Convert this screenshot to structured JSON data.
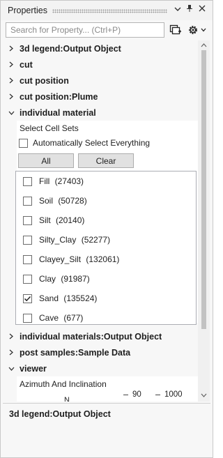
{
  "panel": {
    "title": "Properties",
    "search_placeholder": "Search for Property... (Ctrl+P)"
  },
  "tree_items": [
    {
      "label": "3d legend:Output Object",
      "expanded": false
    },
    {
      "label": "cut",
      "expanded": false
    },
    {
      "label": "cut position",
      "expanded": false
    },
    {
      "label": "cut position:Plume",
      "expanded": false
    },
    {
      "label": "individual material",
      "expanded": true
    },
    {
      "label": "individual materials:Output Object",
      "expanded": false
    },
    {
      "label": "post samples:Sample Data",
      "expanded": false
    },
    {
      "label": "viewer",
      "expanded": true
    }
  ],
  "individual_material": {
    "select_cell_sets_label": "Select Cell Sets",
    "auto_select_label": "Automatically Select Everything",
    "auto_select_checked": false,
    "all_button": "All",
    "clear_button": "Clear",
    "cell_sets": [
      {
        "name": "Fill",
        "count": "(27403)",
        "checked": false
      },
      {
        "name": "Soil",
        "count": "(50728)",
        "checked": false
      },
      {
        "name": "Silt",
        "count": "(20140)",
        "checked": false
      },
      {
        "name": "Silty_Clay",
        "count": "(52277)",
        "checked": false
      },
      {
        "name": "Clayey_Silt",
        "count": "(132061)",
        "checked": false
      },
      {
        "name": "Clay",
        "count": "(91987)",
        "checked": false
      },
      {
        "name": "Sand",
        "count": "(135524)",
        "checked": true
      },
      {
        "name": "Cave",
        "count": "(677)",
        "checked": false
      }
    ]
  },
  "viewer": {
    "azimuth_label": "Azimuth And Inclination",
    "partial_n": "N",
    "value_1": "90",
    "value_2": "1000"
  },
  "description": {
    "title": "3d legend:Output Object"
  },
  "colors": {
    "panel_bg": "#f7f7f7",
    "inner_bg": "#ffffff",
    "button_bg": "#e1e1e1",
    "text": "#1e1e1e"
  }
}
